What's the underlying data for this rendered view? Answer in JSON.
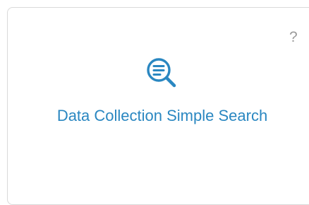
{
  "card": {
    "title": "Data Collection Simple Search",
    "help_label": "?",
    "icon": "search-list-icon"
  },
  "colors": {
    "accent": "#2a87c1",
    "help": "#9a9a9a",
    "border": "#d9d9d9"
  }
}
